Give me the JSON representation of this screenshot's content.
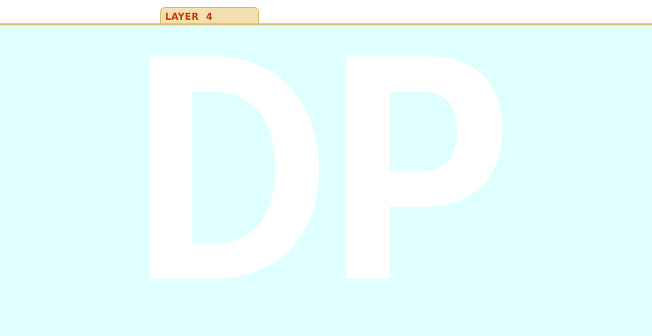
{
  "tabs": [
    {
      "label": "LAYER  4",
      "active": true
    }
  ],
  "colors": {
    "tab_background": "#f2e0b0",
    "tab_border": "#d9b86a",
    "tab_text": "#cc3300",
    "divider": "#dcc070",
    "canvas_background": "#e0ffff",
    "watermark": "#ffffff"
  },
  "canvas": {
    "watermark_text": "DP"
  }
}
